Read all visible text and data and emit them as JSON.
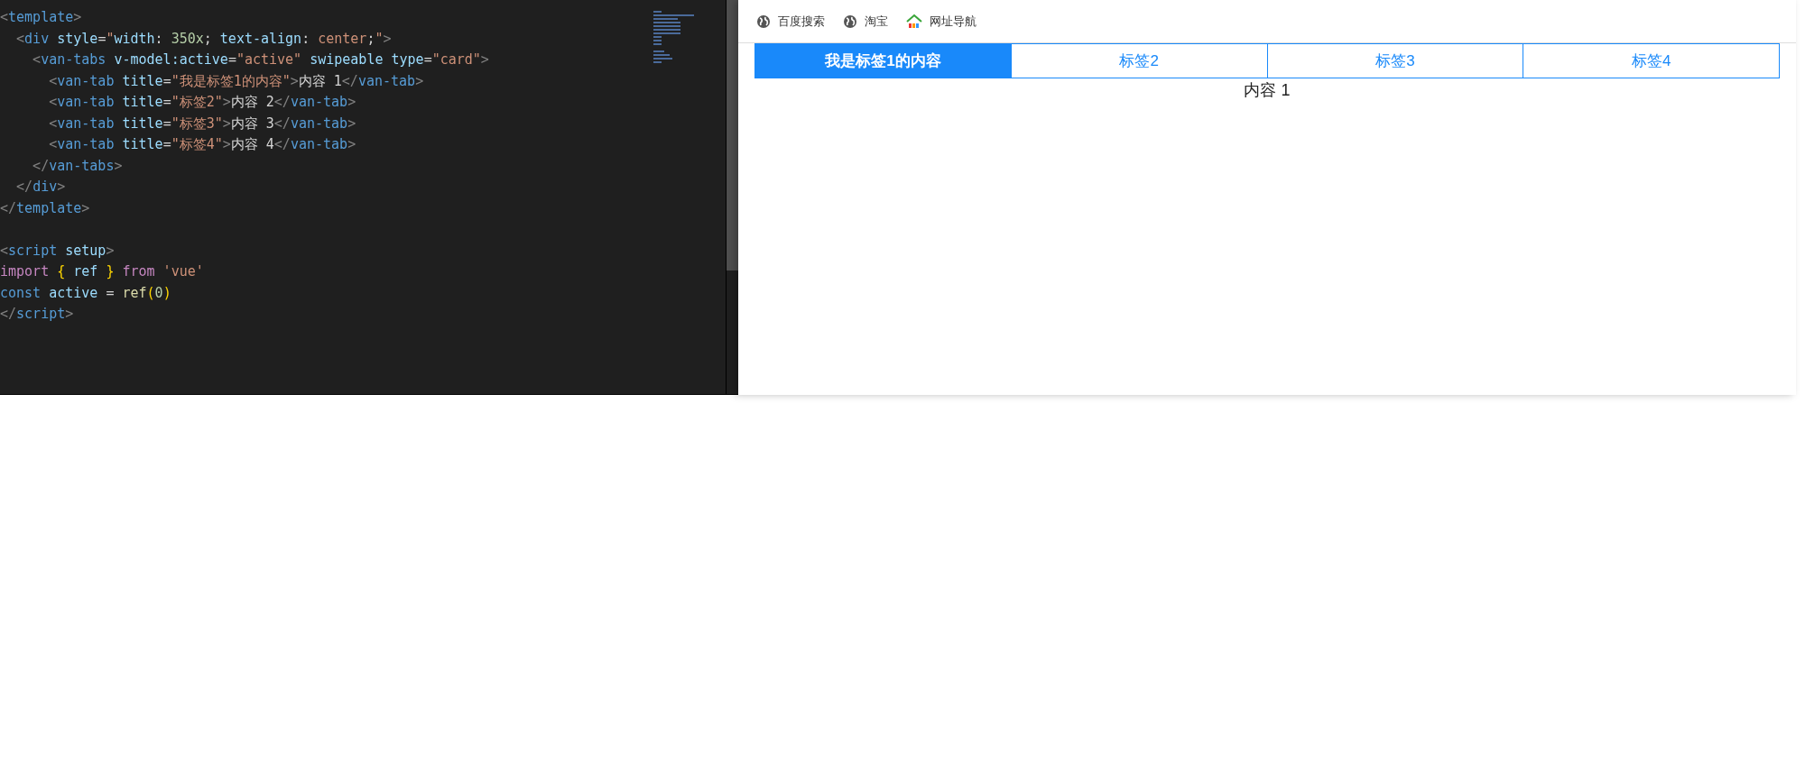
{
  "editor": {
    "lines": [
      [
        {
          "kind": "punct",
          "text": "<"
        },
        {
          "kind": "tag",
          "text": "template"
        },
        {
          "kind": "punct",
          "text": ">"
        }
      ],
      [
        {
          "kind": "punct",
          "text": "  <"
        },
        {
          "kind": "tag",
          "text": "div"
        },
        {
          "kind": "attr",
          "text": " style"
        },
        {
          "kind": "text",
          "text": "="
        },
        {
          "kind": "str",
          "text": "\""
        },
        {
          "kind": "attr",
          "text": "width"
        },
        {
          "kind": "text",
          "text": ": "
        },
        {
          "kind": "num",
          "text": "350x"
        },
        {
          "kind": "text",
          "text": "; "
        },
        {
          "kind": "attr",
          "text": "text-align"
        },
        {
          "kind": "text",
          "text": ": "
        },
        {
          "kind": "str",
          "text": "center"
        },
        {
          "kind": "text",
          "text": ";"
        },
        {
          "kind": "str",
          "text": "\""
        },
        {
          "kind": "punct",
          "text": ">"
        }
      ],
      [
        {
          "kind": "punct",
          "text": "    <"
        },
        {
          "kind": "tag",
          "text": "van-tabs"
        },
        {
          "kind": "attr",
          "text": " v-model:active"
        },
        {
          "kind": "text",
          "text": "="
        },
        {
          "kind": "str",
          "text": "\"active\""
        },
        {
          "kind": "attr",
          "text": " swipeable type"
        },
        {
          "kind": "text",
          "text": "="
        },
        {
          "kind": "str",
          "text": "\"card\""
        },
        {
          "kind": "punct",
          "text": ">"
        }
      ],
      [
        {
          "kind": "punct",
          "text": "      <"
        },
        {
          "kind": "tag",
          "text": "van-tab"
        },
        {
          "kind": "attr",
          "text": " title"
        },
        {
          "kind": "text",
          "text": "="
        },
        {
          "kind": "str",
          "text": "\"我是标签1的内容\""
        },
        {
          "kind": "punct",
          "text": ">"
        },
        {
          "kind": "text",
          "text": "内容 1"
        },
        {
          "kind": "punct",
          "text": "</"
        },
        {
          "kind": "tag",
          "text": "van-tab"
        },
        {
          "kind": "punct",
          "text": ">"
        }
      ],
      [
        {
          "kind": "punct",
          "text": "      <"
        },
        {
          "kind": "tag",
          "text": "van-tab"
        },
        {
          "kind": "attr",
          "text": " title"
        },
        {
          "kind": "text",
          "text": "="
        },
        {
          "kind": "str",
          "text": "\"标签2\""
        },
        {
          "kind": "punct",
          "text": ">"
        },
        {
          "kind": "text",
          "text": "内容 2"
        },
        {
          "kind": "punct",
          "text": "</"
        },
        {
          "kind": "tag",
          "text": "van-tab"
        },
        {
          "kind": "punct",
          "text": ">"
        }
      ],
      [
        {
          "kind": "punct",
          "text": "      <"
        },
        {
          "kind": "tag",
          "text": "van-tab"
        },
        {
          "kind": "attr",
          "text": " title"
        },
        {
          "kind": "text",
          "text": "="
        },
        {
          "kind": "str",
          "text": "\"标签3\""
        },
        {
          "kind": "punct",
          "text": ">"
        },
        {
          "kind": "text",
          "text": "内容 3"
        },
        {
          "kind": "punct",
          "text": "</"
        },
        {
          "kind": "tag",
          "text": "van-tab"
        },
        {
          "kind": "punct",
          "text": ">"
        }
      ],
      [
        {
          "kind": "punct",
          "text": "      <"
        },
        {
          "kind": "tag",
          "text": "van-tab"
        },
        {
          "kind": "attr",
          "text": " title"
        },
        {
          "kind": "text",
          "text": "="
        },
        {
          "kind": "str",
          "text": "\"标签4\""
        },
        {
          "kind": "punct",
          "text": ">"
        },
        {
          "kind": "text",
          "text": "内容 4"
        },
        {
          "kind": "punct",
          "text": "</"
        },
        {
          "kind": "tag",
          "text": "van-tab"
        },
        {
          "kind": "punct",
          "text": ">"
        }
      ],
      [
        {
          "kind": "punct",
          "text": "    </"
        },
        {
          "kind": "tag",
          "text": "van-tabs"
        },
        {
          "kind": "punct",
          "text": ">"
        }
      ],
      [
        {
          "kind": "punct",
          "text": "  </"
        },
        {
          "kind": "tag",
          "text": "div"
        },
        {
          "kind": "punct",
          "text": ">"
        }
      ],
      [
        {
          "kind": "punct",
          "text": "</"
        },
        {
          "kind": "tag",
          "text": "template"
        },
        {
          "kind": "punct",
          "text": ">"
        }
      ],
      {
        "kind": "blank"
      },
      [
        {
          "kind": "punct",
          "text": "<"
        },
        {
          "kind": "tag",
          "text": "script"
        },
        {
          "kind": "attr",
          "text": " setup"
        },
        {
          "kind": "punct",
          "text": ">"
        }
      ],
      [
        {
          "kind": "kw",
          "text": "import "
        },
        {
          "kind": "brace",
          "text": "{"
        },
        {
          "kind": "attr",
          "text": " ref "
        },
        {
          "kind": "brace",
          "text": "}"
        },
        {
          "kind": "kw",
          "text": " from"
        },
        {
          "kind": "str",
          "text": " 'vue'"
        }
      ],
      [
        {
          "kind": "tag",
          "text": "const"
        },
        {
          "kind": "attr",
          "text": " active"
        },
        {
          "kind": "text",
          "text": " = "
        },
        {
          "kind": "fn",
          "text": "ref"
        },
        {
          "kind": "brace",
          "text": "("
        },
        {
          "kind": "num",
          "text": "0"
        },
        {
          "kind": "brace",
          "text": ")"
        }
      ],
      [
        {
          "kind": "punct",
          "text": "</"
        },
        {
          "kind": "tag",
          "text": "script"
        },
        {
          "kind": "punct",
          "text": ">"
        }
      ]
    ]
  },
  "browser": {
    "bookmarks": [
      {
        "kind": "globe",
        "label": "百度搜索"
      },
      {
        "kind": "globe",
        "label": "淘宝"
      },
      {
        "kind": "house",
        "label": "网址导航"
      }
    ],
    "tabs": [
      {
        "label": "我是标签1的内容",
        "selected": true
      },
      {
        "label": "标签2",
        "selected": false
      },
      {
        "label": "标签3",
        "selected": false
      },
      {
        "label": "标签4",
        "selected": false
      }
    ],
    "content": "内容 1"
  }
}
